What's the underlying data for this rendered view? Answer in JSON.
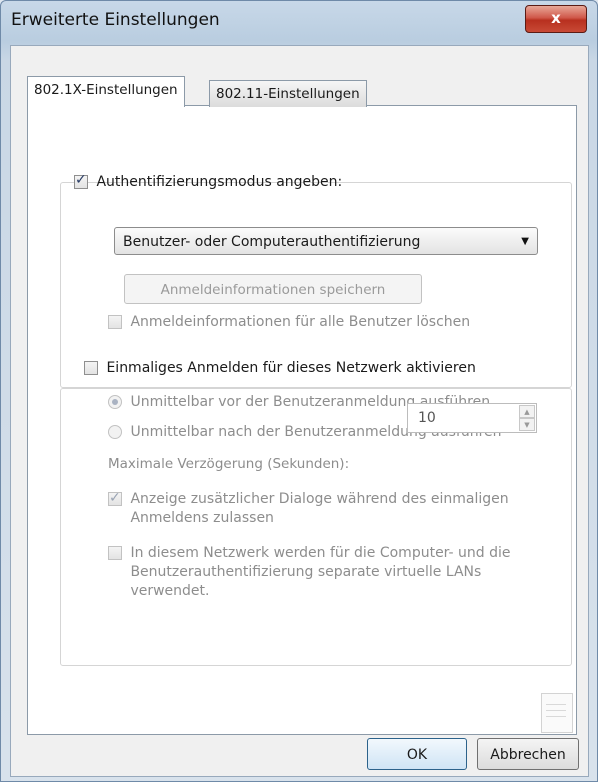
{
  "window": {
    "title": "Erweiterte Einstellungen",
    "close_glyph": "x",
    "close_icon": "close-icon"
  },
  "tabs": [
    {
      "label": "802.1X-Einstellungen",
      "active": true
    },
    {
      "label": "802.11-Einstellungen",
      "active": false
    }
  ],
  "auth": {
    "mode_label": "Authentifizierungsmodus angeben:",
    "mode_checked": true,
    "mode_value": "Benutzer- oder Computerauthentifizierung",
    "dropdown_arrow": "▼",
    "save_credentials_label": "Anmeldeinformationen speichern",
    "delete_credentials_label": "Anmeldeinformationen für alle Benutzer löschen",
    "delete_credentials_checked": false
  },
  "sso": {
    "enable_label": "Einmaliges Anmelden für dieses Netzwerk aktivieren",
    "enable_checked": false,
    "before_logon_label": "Unmittelbar vor der Benutzeranmeldung ausführen",
    "before_logon_selected": true,
    "after_logon_label": "Unmittelbar nach der Benutzeranmeldung ausführen",
    "after_logon_selected": false,
    "max_delay_label": "Maximale Verzögerung (Sekunden):",
    "max_delay_value": "10",
    "spin_up": "▲",
    "spin_down": "▼",
    "additional_dialogs_line1": "Anzeige zusätzlicher Dialoge während des einmaligen",
    "additional_dialogs_line2": "Anmeldens zulassen",
    "additional_dialogs_checked": true,
    "separate_vlan_line1": "In diesem Netzwerk werden für die Computer- und die",
    "separate_vlan_line2": "Benutzerauthentifizierung separate virtuelle LANs",
    "separate_vlan_line3": "verwendet.",
    "separate_vlan_checked": false
  },
  "buttons": {
    "ok_label": "OK",
    "cancel_label": "Abbrechen"
  },
  "colors": {
    "close_button": "#c84a36",
    "default_button_border": "#2c628b",
    "check_mark": "#2a3d66"
  }
}
